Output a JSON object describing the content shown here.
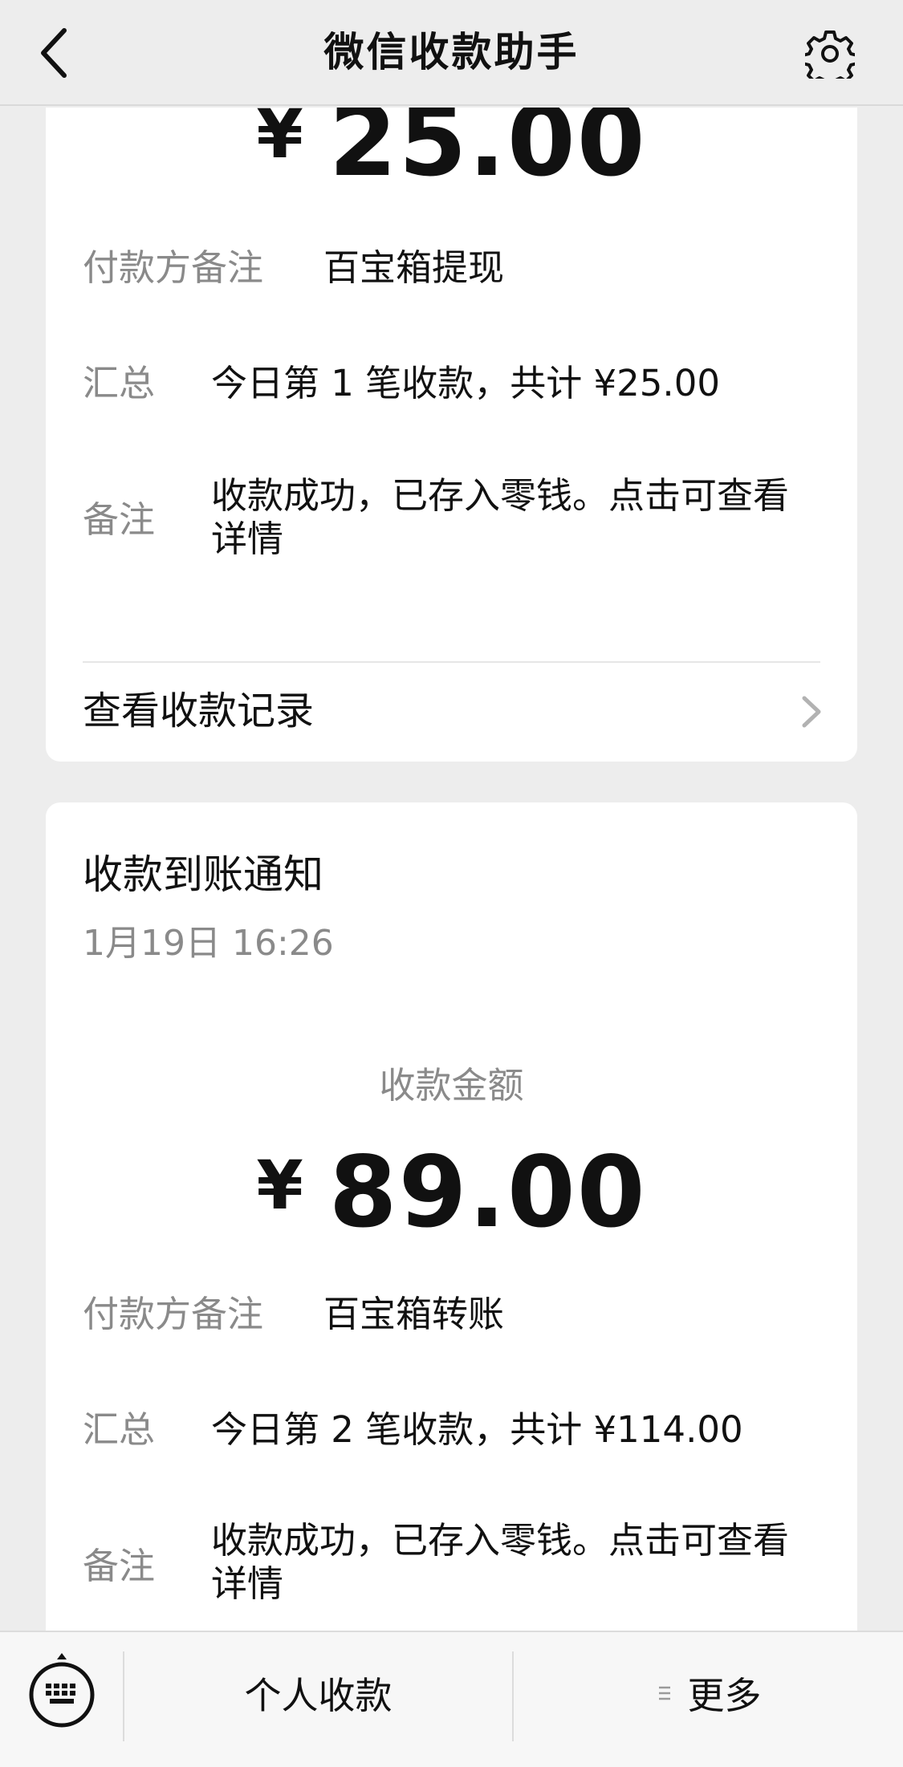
{
  "header": {
    "title": "微信收款助手",
    "back_icon": "chevron-left-icon",
    "settings_icon": "gear-icon"
  },
  "card1": {
    "currency": "¥",
    "amount": "25.00",
    "payer_note_label": "付款方备注",
    "payer_note_value": "百宝箱提现",
    "summary_label": "汇总",
    "summary_value": "今日第 1 笔收款，共计 ¥25.00",
    "remark_label": "备注",
    "remark_line1": "收款成功，已存入零钱。点击可查看",
    "remark_line2": "详情",
    "records_label": "查看收款记录"
  },
  "card2": {
    "title": "收款到账通知",
    "time": "1月19日 16:26",
    "amount_label": "收款金额",
    "currency": "¥",
    "amount": "89.00",
    "payer_note_label": "付款方备注",
    "payer_note_value": "百宝箱转账",
    "summary_label": "汇总",
    "summary_value": "今日第 2 笔收款，共计 ¥114.00",
    "remark_label": "备注",
    "remark_line1": "收款成功，已存入零钱。点击可查看",
    "remark_line2": "详情"
  },
  "bottom_bar": {
    "keyboard_icon": "keyboard-icon",
    "personal_collect": "个人收款",
    "more": "更多",
    "more_icon": "menu-lines-icon"
  },
  "colors": {
    "background": "#ededed",
    "card": "#ffffff",
    "secondary_text": "#8a8a8a"
  }
}
